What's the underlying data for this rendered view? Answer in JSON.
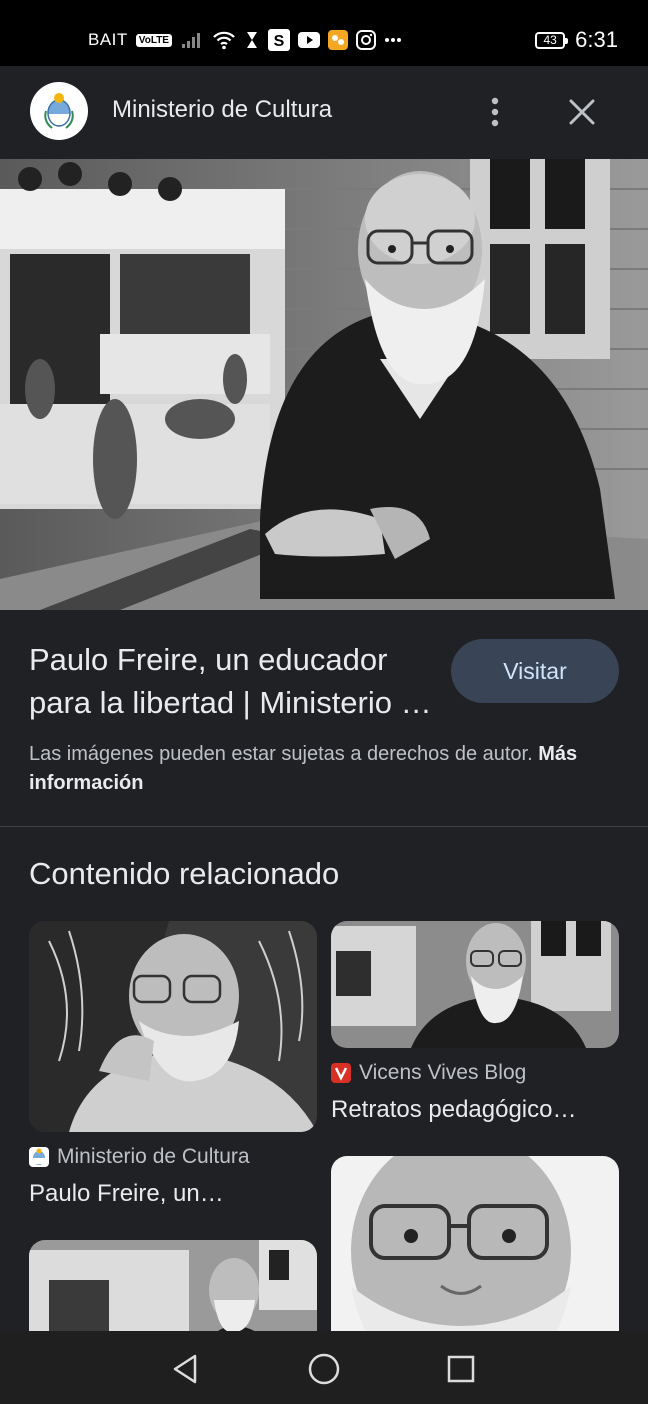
{
  "status_bar": {
    "carrier": "BAIT",
    "volte": "VoLTE",
    "battery": "43",
    "time": "6:31",
    "icons": [
      "signal-icon",
      "wifi-icon",
      "hourglass-icon",
      "s-app-icon",
      "youtube-icon",
      "app-icon",
      "instagram-icon",
      "more-icon"
    ]
  },
  "header": {
    "site_name": "Ministerio de Cultura",
    "logo_icon": "argentina-coat-of-arms-icon",
    "menu_icon": "more-vert-icon",
    "close_icon": "close-icon"
  },
  "result": {
    "title": "Paulo Freire, un educador para la libertad | Ministerio de Cultura",
    "visit_label": "Visitar",
    "copyright_text": "Las imágenes pueden estar sujetas a derechos de autor.",
    "more_info_label": "Más información"
  },
  "related": {
    "heading": "Contenido relacionado",
    "items": [
      {
        "source": "Ministerio de Cultura",
        "caption": "Paulo Freire, un…"
      },
      {
        "source": "Vicens Vives Blog",
        "caption": "Retratos pedagógico…"
      }
    ]
  },
  "nav_bar": {
    "back_icon": "back-triangle-icon",
    "home_icon": "home-circle-icon",
    "recents_icon": "recents-square-icon"
  },
  "colors": {
    "background": "#202124",
    "visit_button": "#394457",
    "vicens_red": "#d93025"
  }
}
